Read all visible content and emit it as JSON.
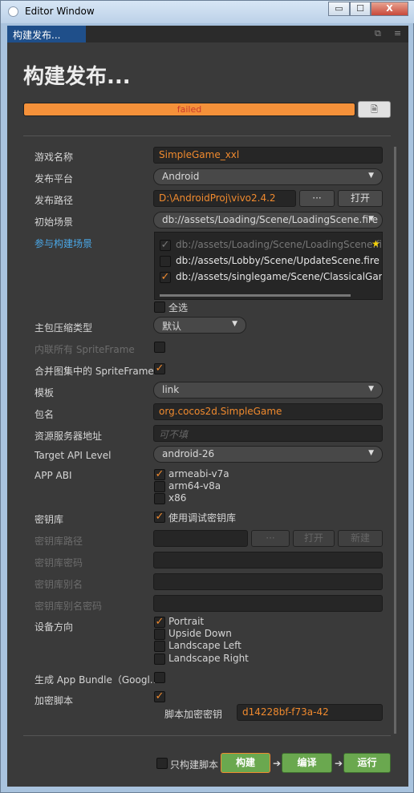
{
  "window": {
    "title": "Editor Window",
    "min_label": "▭",
    "max_label": "☐",
    "close_label": "X"
  },
  "tab": {
    "label": "构建发布...",
    "popout_icon": "popout-icon",
    "menu_icon": "menu-icon"
  },
  "header": {
    "title": "构建发布...",
    "progress_text": "failed",
    "progress_value": 100,
    "progress_color": "#f5913a"
  },
  "form": {
    "game_name_label": "游戏名称",
    "game_name_value": "SimpleGame_xxl",
    "platform_label": "发布平台",
    "platform_value": "Android",
    "path_label": "发布路径",
    "path_value": "D:\\AndroidProj\\vivo2.4.2",
    "path_browse": "···",
    "path_open": "打开",
    "start_scene_label": "初始场景",
    "start_scene_value": "db://assets/Loading/Scene/LoadingScene.fire",
    "scenes_label": "参与构建场景",
    "scenes": [
      {
        "path": "db://assets/Loading/Scene/LoadingScene.fire",
        "checked": true,
        "disabled": true
      },
      {
        "path": "db://assets/Lobby/Scene/UpdateScene.fire",
        "checked": false,
        "disabled": false
      },
      {
        "path": "db://assets/singlegame/Scene/ClassicalGameScene.fire",
        "checked": true,
        "disabled": false
      }
    ],
    "select_all": "全选",
    "compress_label": "主包压缩类型",
    "compress_value": "默认",
    "inline_sf_label": "内联所有 SpriteFrame",
    "merge_sf_label": "合并图集中的 SpriteFrame",
    "template_label": "模板",
    "template_value": "link",
    "package_label": "包名",
    "package_value": "org.cocos2d.SimpleGame",
    "server_label": "资源服务器地址",
    "server_placeholder": "可不填",
    "api_label": "Target API Level",
    "api_value": "android-26",
    "abi_label": "APP ABI",
    "abi_options": [
      "armeabi-v7a",
      "arm64-v8a",
      "x86"
    ],
    "keystore_label": "密钥库",
    "keystore_debug": "使用调试密钥库",
    "ks_path_label": "密钥库路径",
    "ks_browse": "···",
    "ks_open": "打开",
    "ks_new": "新建",
    "ks_pwd_label": "密钥库密码",
    "ks_alias_label": "密钥库别名",
    "ks_alias_pwd_label": "密钥库别名密码",
    "orientation_label": "设备方向",
    "orientations": [
      "Portrait",
      "Upside Down",
      "Landscape Left",
      "Landscape Right"
    ],
    "bundle_label": "生成 App Bundle（Googl...",
    "encrypt_label": "加密脚本",
    "encrypt_key_label": "脚本加密密钥",
    "encrypt_key_value": "d14228bf-f73a-42"
  },
  "actions": {
    "only_script": "只构建脚本",
    "build": "构建",
    "compile": "编译",
    "run": "运行",
    "arrow": "➔",
    "build_color": "#6aa84f",
    "accent": "#f08a2e"
  }
}
